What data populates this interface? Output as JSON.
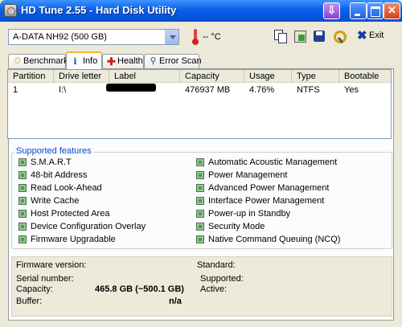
{
  "window": {
    "title": "HD Tune 2.55 - Hard Disk Utility"
  },
  "toolbar": {
    "drive": "A-DATA  NH92 (500 GB)",
    "temperature": "-- °C",
    "exit_label": "Exit"
  },
  "tabs": [
    {
      "label": "Benchmark",
      "icon": "stopwatch-icon"
    },
    {
      "label": "Info",
      "icon": "info-icon",
      "active": true
    },
    {
      "label": "Health",
      "icon": "cross-icon"
    },
    {
      "label": "Error Scan",
      "icon": "magnifier-icon"
    }
  ],
  "partitions": {
    "columns": [
      "Partition",
      "Drive letter",
      "Label",
      "Capacity",
      "Usage",
      "Type",
      "Bootable"
    ],
    "rows": [
      [
        "1",
        "I:\\",
        "",
        "476937 MB",
        "4.76%",
        "NTFS",
        "Yes"
      ]
    ]
  },
  "features": {
    "title": "Supported features",
    "left": [
      "S.M.A.R.T",
      "48-bit Address",
      "Read Look-Ahead",
      "Write Cache",
      "Host Protected Area",
      "Device Configuration Overlay",
      "Firmware Upgradable"
    ],
    "right": [
      "Automatic Acoustic Management",
      "Power Management",
      "Advanced Power Management",
      "Interface Power Management",
      "Power-up in Standby",
      "Security Mode",
      "Native Command Queuing (NCQ)"
    ]
  },
  "info": {
    "firmware_label": "Firmware version:",
    "firmware_value": "",
    "serial_label": "Serial number:",
    "serial_value": "",
    "capacity_label": "Capacity:",
    "capacity_value": "465.8 GB (~500.1 GB)",
    "buffer_label": "Buffer:",
    "buffer_value": "n/a",
    "standard_label": "Standard:",
    "supported_label": "Supported:",
    "active_label": "Active:"
  },
  "colors": {
    "titlebar": "#0553d6",
    "group_title": "#0046d5",
    "feature_box": "#8fc88f",
    "tab_highlight": "#f7b330"
  }
}
